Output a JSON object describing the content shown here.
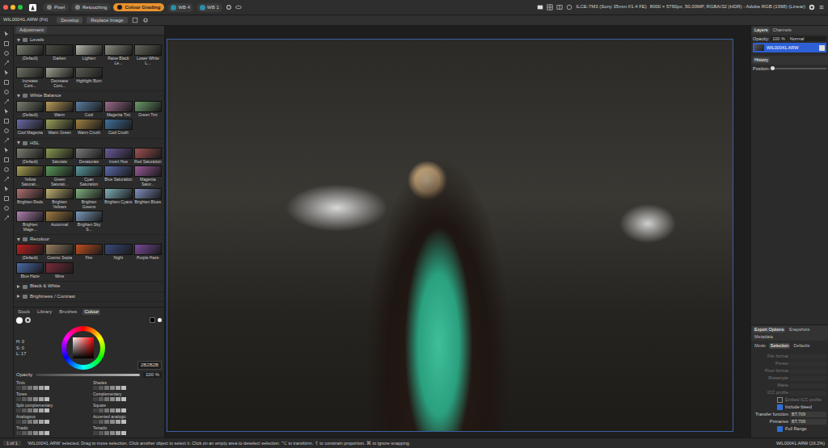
{
  "window": {
    "traffic_lights": [
      {
        "name": "close",
        "color": "#ff5f57"
      },
      {
        "name": "minimise",
        "color": "#febc2e"
      },
      {
        "name": "zoom",
        "color": "#28c840"
      }
    ]
  },
  "toolbar": {
    "personas": [
      {
        "label": "Pixel",
        "selected": false
      },
      {
        "label": "Retouching",
        "selected": false
      },
      {
        "label": "Colour Grading",
        "selected": true
      }
    ],
    "wb_buttons": [
      "WB 4",
      "WB 1"
    ],
    "camera": "ILCE-7M3 (Sony 35mm f/1.4 FE)",
    "image_info": "8000 × 5760px, 50.00MP, RGBA/32 (HDR) - Adobe RGB (1998) (Linear)"
  },
  "context_bar": {
    "document": "WIL00041.ARW (Fit)",
    "buttons": [
      "Develop",
      "Replace Image"
    ]
  },
  "adjustment_panel": {
    "title": "Adjustment",
    "sections": [
      {
        "title": "Levels",
        "expanded": true,
        "presets": [
          {
            "label": "(Default)",
            "color": "#7a7f70"
          },
          {
            "label": "Darken",
            "color": "#4a4d44"
          },
          {
            "label": "Lighten",
            "color": "#b4b8aa"
          },
          {
            "label": "Raise Black Le...",
            "color": "#8a8d80"
          },
          {
            "label": "Lower White L...",
            "color": "#62665a"
          },
          {
            "label": "Increase Cont...",
            "color": "#6f7463"
          },
          {
            "label": "Decrease Cont...",
            "color": "#9da090"
          },
          {
            "label": "Highlight Burn",
            "color": "#5b5e52"
          }
        ]
      },
      {
        "title": "White Balance",
        "expanded": true,
        "presets": [
          {
            "label": "(Default)",
            "color": "#7a7f70"
          },
          {
            "label": "Warm",
            "color": "#b89a5a"
          },
          {
            "label": "Cool",
            "color": "#5a7ea0"
          },
          {
            "label": "Magenta Tint",
            "color": "#9a6a8a"
          },
          {
            "label": "Green Tint",
            "color": "#6a9a6a"
          },
          {
            "label": "Cool Magenta",
            "color": "#6a6aa8"
          },
          {
            "label": "Warm Green",
            "color": "#9aa05a"
          },
          {
            "label": "Warm Crush",
            "color": "#a08040"
          },
          {
            "label": "Cool Crush",
            "color": "#40709a"
          }
        ]
      },
      {
        "title": "HSL",
        "expanded": true,
        "presets": [
          {
            "label": "(Default)",
            "color": "#7a7f70"
          },
          {
            "label": "Saturate",
            "color": "#8a9a50"
          },
          {
            "label": "Desaturate",
            "color": "#7a7a7a"
          },
          {
            "label": "Invert Hue",
            "color": "#6a5a9a"
          },
          {
            "label": "Red Saturation",
            "color": "#a05050"
          },
          {
            "label": "Yellow Saturati...",
            "color": "#a8a050"
          },
          {
            "label": "Green Saturati...",
            "color": "#5a9a5a"
          },
          {
            "label": "Cyan Saturation",
            "color": "#5a9aa0"
          },
          {
            "label": "Blue Saturation",
            "color": "#5a6aaa"
          },
          {
            "label": "Magenta Satur...",
            "color": "#9a5a9a"
          },
          {
            "label": "Brighten Reds",
            "color": "#b07070"
          },
          {
            "label": "Brighten Yellows",
            "color": "#c0b070"
          },
          {
            "label": "Brighten Greens",
            "color": "#80b080"
          },
          {
            "label": "Brighten Cyans",
            "color": "#80b0b8"
          },
          {
            "label": "Brighten Blues",
            "color": "#8090c0"
          },
          {
            "label": "Brighten Mage...",
            "color": "#b080b0"
          },
          {
            "label": "Autumnal",
            "color": "#a07a40"
          },
          {
            "label": "Brighten Sky S...",
            "color": "#7a9ab8"
          }
        ]
      },
      {
        "title": "Recolour",
        "expanded": true,
        "presets": [
          {
            "label": "(Default)",
            "color": "#c02020"
          },
          {
            "label": "Cosmic Sepia",
            "color": "#9a8060"
          },
          {
            "label": "Fire",
            "color": "#c05020"
          },
          {
            "label": "Night",
            "color": "#3a4a7a"
          },
          {
            "label": "Purple Haze",
            "color": "#7a4a9a"
          },
          {
            "label": "Blue Haze",
            "color": "#4a6aaa"
          },
          {
            "label": "Wine",
            "color": "#7a2a3a"
          }
        ]
      },
      {
        "title": "Black & White",
        "expanded": false,
        "presets": []
      },
      {
        "title": "Brightness / Contrast",
        "expanded": false,
        "presets": []
      }
    ]
  },
  "colour_panel": {
    "tabs": [
      {
        "label": "Stock",
        "selected": false
      },
      {
        "label": "Library",
        "selected": false
      },
      {
        "label": "Brushes",
        "selected": false
      },
      {
        "label": "Colour",
        "selected": true
      }
    ],
    "readouts": [
      "H: 0",
      "S: 0",
      "L: 17"
    ],
    "hex": "2B2B2B",
    "opacity_label": "Opacity",
    "opacity": "100 %",
    "opacity_level": 1,
    "harmonies": [
      "Tints",
      "Shades",
      "Tones",
      "Complementary",
      "Split complementary",
      "Square",
      "Analogous",
      "Accented analogic",
      "Triadic",
      "Tetradic"
    ]
  },
  "layers_panel": {
    "tabs": [
      {
        "label": "Layers",
        "selected": true
      },
      {
        "label": "Channels",
        "selected": false
      }
    ],
    "opacity_label": "Opacity:",
    "opacity": "100 %",
    "blend": "Normal",
    "layers": [
      {
        "name": "WIL00041.ARW",
        "selected": true,
        "visible": true
      }
    ]
  },
  "history_panel": {
    "title": "History",
    "position_label": "Position:",
    "level": 0
  },
  "export_panel": {
    "tabs": [
      {
        "label": "Export Options",
        "selected": true
      },
      {
        "label": "Snapshots",
        "selected": false
      },
      {
        "label": "Metadata",
        "selected": false
      }
    ],
    "subtabs": [
      {
        "label": "Mode",
        "selected": false
      },
      {
        "label": "Selection",
        "selected": true
      },
      {
        "label": "Defaults",
        "selected": false
      }
    ],
    "fields": [
      {
        "kind": "field",
        "label": "File format",
        "value": "",
        "disabled": true
      },
      {
        "kind": "field",
        "label": "Preset",
        "value": "",
        "disabled": true
      },
      {
        "kind": "field",
        "label": "Pixel format",
        "value": "",
        "disabled": true
      },
      {
        "kind": "field",
        "label": "Resample",
        "value": "",
        "disabled": true
      },
      {
        "kind": "field",
        "label": "Matte",
        "value": "",
        "disabled": true
      },
      {
        "kind": "field",
        "label": "ICC profile",
        "value": "",
        "disabled": true
      },
      {
        "kind": "checkbox",
        "label": "Embed ICC profile",
        "checked": false,
        "disabled": true
      },
      {
        "kind": "checkbox",
        "label": "Include bleed",
        "checked": true,
        "disabled": false
      },
      {
        "kind": "field",
        "label": "Transfer function",
        "value": "BT.709",
        "disabled": false
      },
      {
        "kind": "field",
        "label": "Primaries",
        "value": "BT.709",
        "disabled": false
      },
      {
        "kind": "checkbox",
        "label": "Full Range",
        "checked": true,
        "disabled": false
      }
    ]
  },
  "status_bar": {
    "page": "1 of 1",
    "message": "'WIL00041.ARW' selected. Drag to move selection. Click another object to select it. Click on an empty area to deselect selection. ⌥ to transform. ⇧ to constrain proportion. ⌘ to ignore snapping.",
    "zoom_info": "WIL00041.ARW (16.2%)"
  }
}
